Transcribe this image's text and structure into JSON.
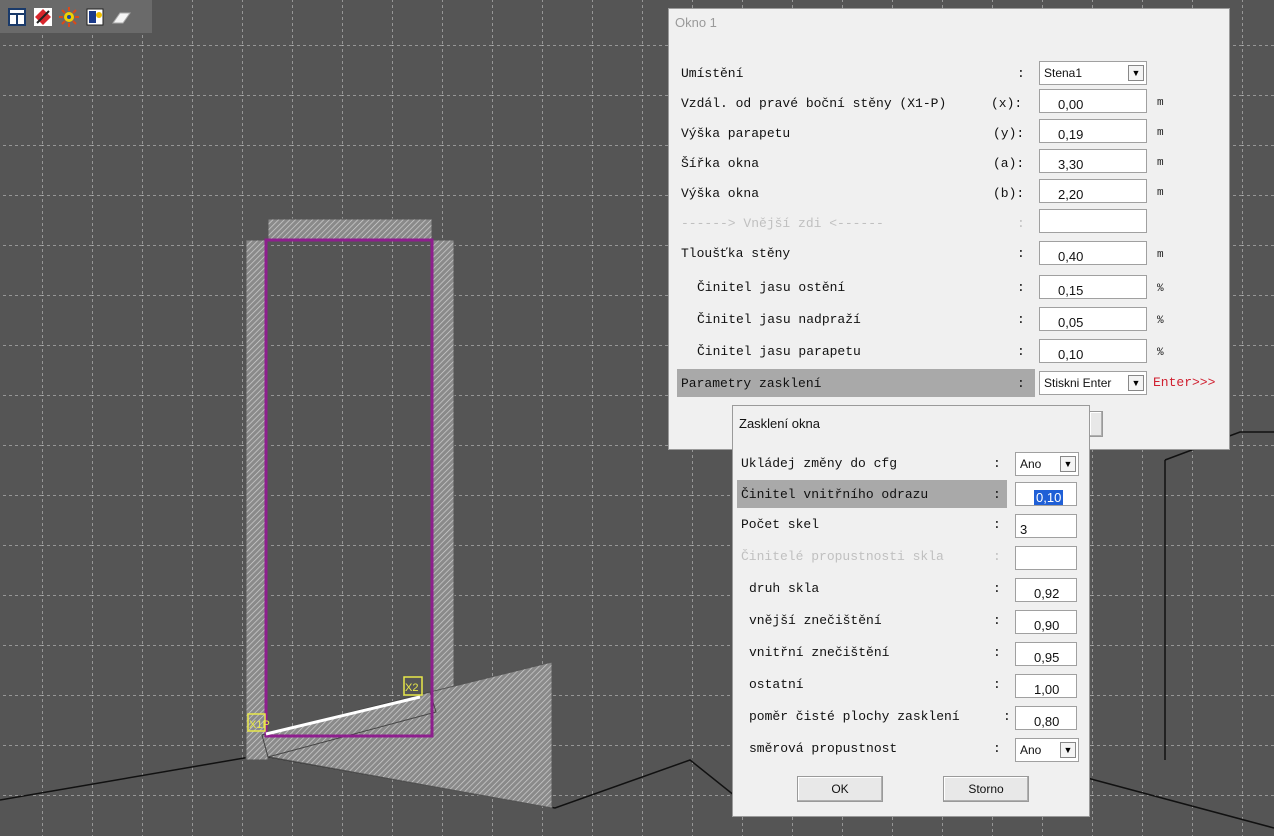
{
  "toolbar": {
    "icons": [
      "table-icon",
      "draw-icon",
      "light-icon",
      "image-icon",
      "eraser-icon"
    ]
  },
  "canvas": {
    "markers": {
      "x1p": "X1P",
      "x2": "X2"
    }
  },
  "window_dialog": {
    "title": "Okno 1",
    "colon": ":",
    "rows": {
      "umisteni": {
        "label": "Umístění",
        "suffix": "",
        "value": "Stena1"
      },
      "x": {
        "label": "Vzdál. od pravé boční stěny (X1-P)",
        "suffix": "(x):",
        "value": "0,00",
        "unit": "m"
      },
      "y": {
        "label": "Výška parapetu",
        "suffix": "(y):",
        "value": "0,19",
        "unit": "m"
      },
      "a": {
        "label": "Šířka okna",
        "suffix": "(a):",
        "value": "3,30",
        "unit": "m"
      },
      "b": {
        "label": "Výška okna",
        "suffix": "(b):",
        "value": "2,20",
        "unit": "m"
      },
      "separator": {
        "label": "------> Vnější zdi <------",
        "value": ""
      },
      "tloustka": {
        "label": "Tloušťka stěny",
        "value": "0,40",
        "unit": "m"
      },
      "osteni": {
        "label": "Činitel jasu ostění",
        "value": "0,15",
        "unit": "%"
      },
      "nadprazi": {
        "label": "Činitel jasu nadpraží",
        "value": "0,05",
        "unit": "%"
      },
      "parapet": {
        "label": "Činitel jasu parapetu",
        "value": "0,10",
        "unit": "%"
      },
      "zaskleni": {
        "label": "Parametry zasklení",
        "value": "Stiskni Enter",
        "hint": "Enter>>>"
      }
    }
  },
  "glazing_dialog": {
    "title": "Zasklení okna",
    "colon": ":",
    "rows": {
      "ukladej": {
        "label": "Ukládej změny do cfg",
        "value": "Ano"
      },
      "odraz": {
        "label": "Činitel vnitřního odrazu",
        "value": "0,10"
      },
      "pocet": {
        "label": "Počet skel",
        "value": "3"
      },
      "propustnost": {
        "label": "Činitelé propustnosti skla",
        "value": ""
      },
      "druh": {
        "label": "druh skla",
        "value": "0,92"
      },
      "vnejsi": {
        "label": "vnější znečištění",
        "value": "0,90"
      },
      "vnitrni": {
        "label": "vnitřní znečištění",
        "value": "0,95"
      },
      "ostatni": {
        "label": "ostatní",
        "value": "1,00"
      },
      "pomer": {
        "label": "poměr čisté plochy zasklení",
        "value": "0,80"
      },
      "smerova": {
        "label": "směrová propustnost",
        "value": "Ano"
      }
    },
    "buttons": {
      "ok": "OK",
      "cancel": "Storno"
    }
  }
}
